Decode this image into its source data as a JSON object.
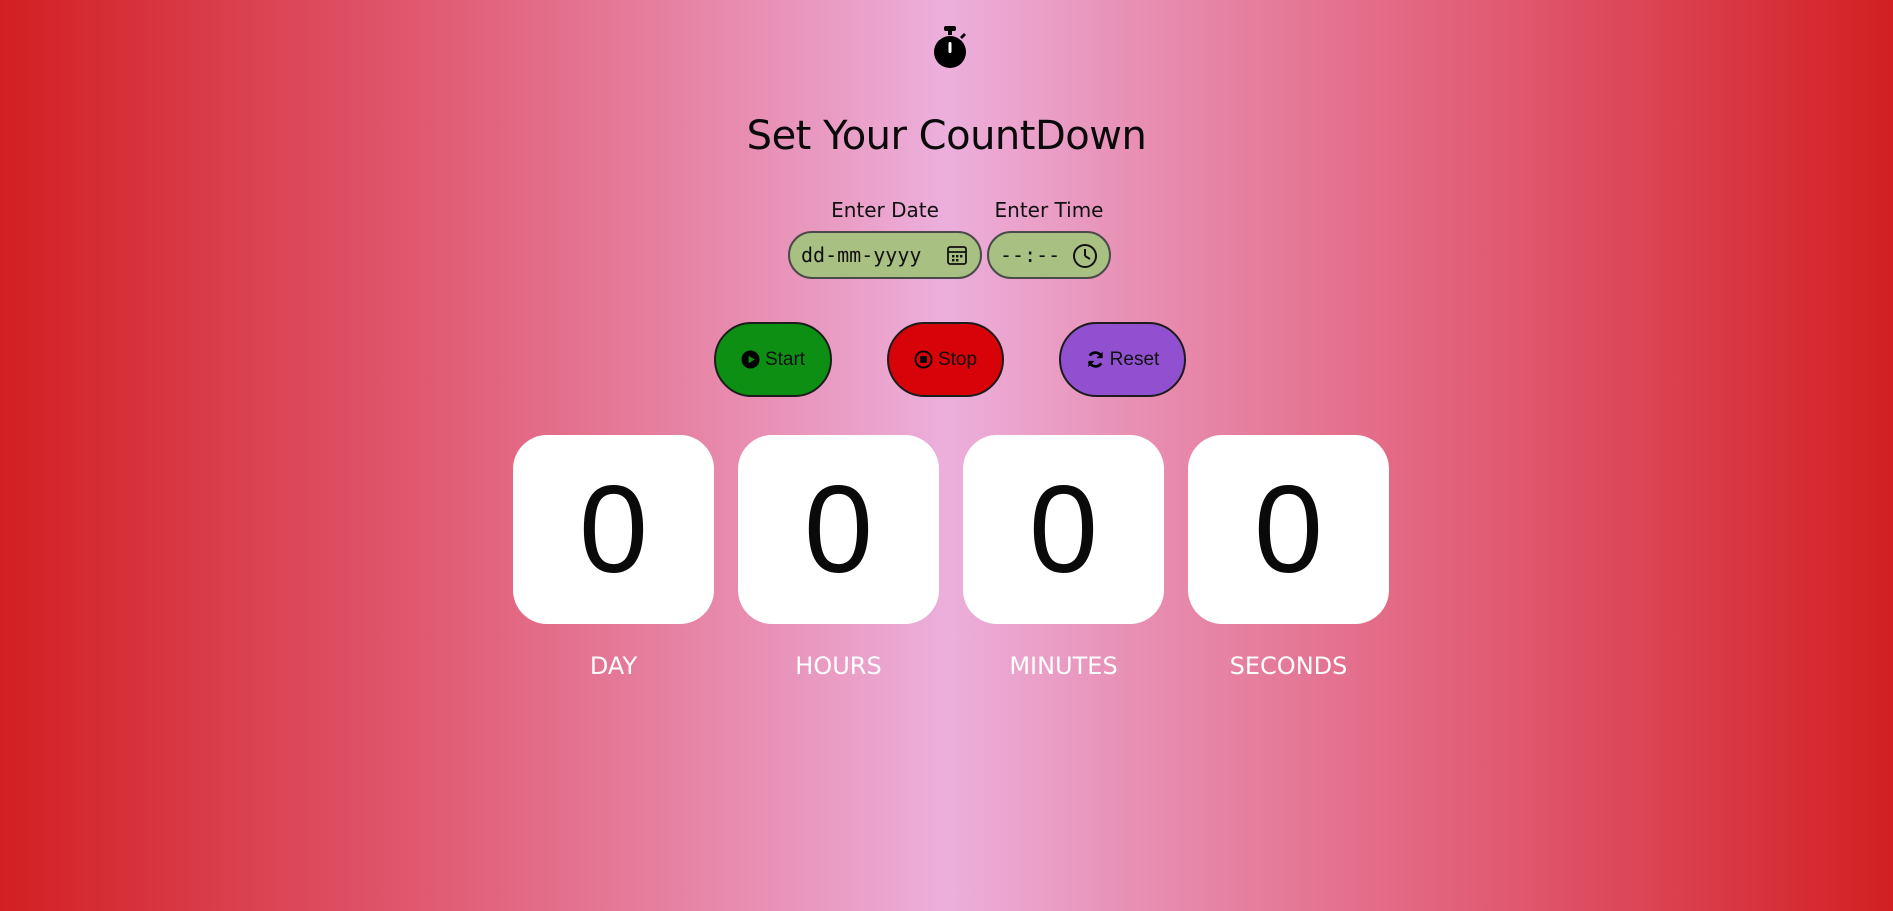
{
  "header": {
    "logo_icon": "stopwatch-icon",
    "title": "Set Your CountDown"
  },
  "form": {
    "date": {
      "label": "Enter Date",
      "placeholder": "dd-mm-yyyy",
      "icon": "calendar-icon"
    },
    "time": {
      "label": "Enter Time",
      "placeholder": "--:--",
      "icon": "clock-icon"
    }
  },
  "buttons": {
    "start": {
      "label": "Start",
      "icon": "play-circle-icon",
      "color": "#0d8f14"
    },
    "stop": {
      "label": "Stop",
      "icon": "stop-circle-icon",
      "color": "#d70309"
    },
    "reset": {
      "label": "Reset",
      "icon": "refresh-icon",
      "color": "#9150cf"
    }
  },
  "countdown": [
    {
      "value": "0",
      "label": "DAY"
    },
    {
      "value": "0",
      "label": "HOURS"
    },
    {
      "value": "0",
      "label": "MINUTES"
    },
    {
      "value": "0",
      "label": "SECONDS"
    }
  ],
  "colors": {
    "background_edge": "#d21f22",
    "background_center": "#ecafdc",
    "field_bg": "#a8c182",
    "card_bg": "#ffffff"
  }
}
